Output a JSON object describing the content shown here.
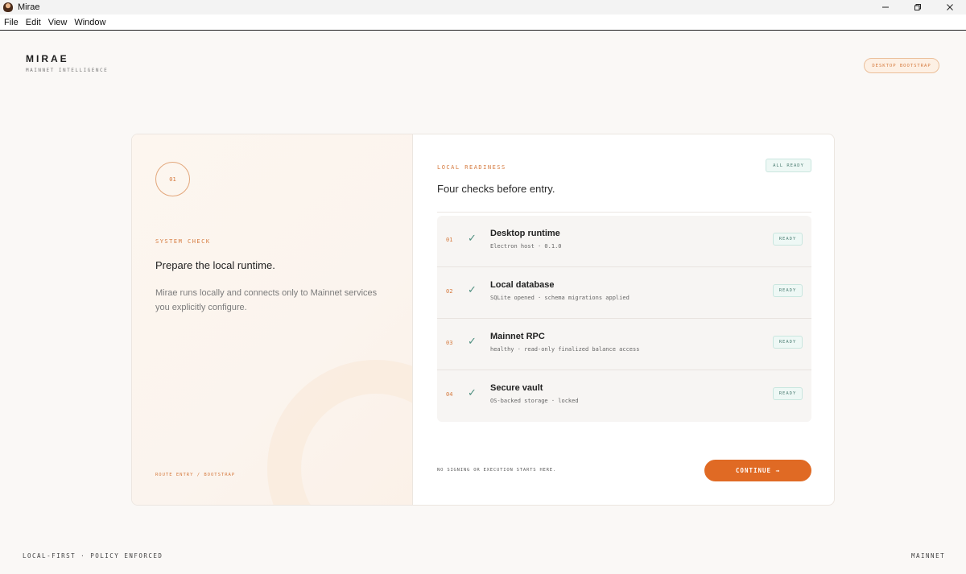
{
  "window": {
    "title": "Mirae",
    "app_icon": "app-avatar-icon"
  },
  "menu": {
    "items": [
      "File",
      "Edit",
      "View",
      "Window"
    ]
  },
  "header": {
    "brand_name": "MIRAE",
    "brand_tagline": "MAINNET INTELLIGENCE",
    "mode_badge": "DESKTOP BOOTSTRAP"
  },
  "left_panel": {
    "step": "01",
    "section_label": "SYSTEM CHECK",
    "heading": "Prepare the local runtime.",
    "description": "Mirae runs locally and connects only to Mainnet services you explicitly configure.",
    "route": "ROUTE ENTRY / BOOTSTRAP"
  },
  "right_panel": {
    "section_label": "LOCAL READINESS",
    "heading": "Four checks before entry.",
    "overall_status": "ALL READY",
    "checks": [
      {
        "num": "01",
        "mark": "✓",
        "title": "Desktop runtime",
        "detail": "Electron host · 0.1.0",
        "status": "READY"
      },
      {
        "num": "02",
        "mark": "✓",
        "title": "Local database",
        "detail": "SQLite opened · schema migrations applied",
        "status": "READY"
      },
      {
        "num": "03",
        "mark": "✓",
        "title": "Mainnet RPC",
        "detail": "healthy · read-only finalized balance access",
        "status": "READY"
      },
      {
        "num": "04",
        "mark": "✓",
        "title": "Secure vault",
        "detail": "OS-backed storage · locked",
        "status": "READY"
      }
    ],
    "footnote": "NO SIGNING OR EXECUTION STARTS HERE.",
    "continue_label": "CONTINUE →"
  },
  "footer": {
    "left": "LOCAL-FIRST · POLICY ENFORCED",
    "right": "MAINNET"
  },
  "colors": {
    "accent": "#e06a24",
    "ready": "#4f7f75",
    "background": "#faf8f6"
  }
}
